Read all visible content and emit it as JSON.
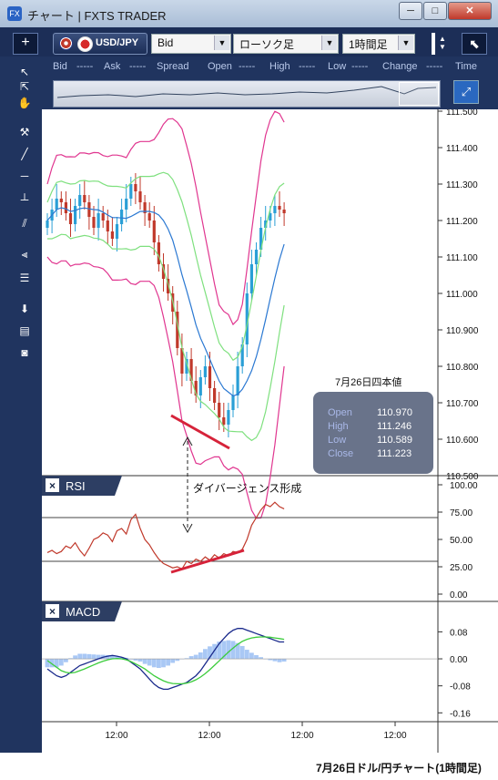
{
  "window": {
    "title": "チャート | FXTS TRADER",
    "app_icon": "FX",
    "controls": {
      "minimize": "minimize-icon",
      "maximize": "maximize-icon",
      "close": "close-icon"
    }
  },
  "toolbar": {
    "plus_label": "+",
    "pair_label": "USD/JPY",
    "price_type": "Bid",
    "chart_type": "ローソク足",
    "timeframe": "1時間足",
    "export_icon": "arrow-up-left-icon"
  },
  "quote_row": {
    "labels": [
      "Bid",
      "-----",
      "Ask",
      "-----",
      "Spread",
      "Open",
      "-----",
      "High",
      "-----",
      "Low",
      "-----",
      "Change",
      "-----",
      "Time"
    ]
  },
  "tools": [
    "pointer-icon",
    "crosshair-pointer-icon",
    "hand-icon",
    "hammer-icon",
    "trendline-icon",
    "horizontal-line-icon",
    "vertical-line-icon",
    "channel-icon",
    "fan-icon",
    "fibonacci-icon",
    "download-icon",
    "list-icon",
    "camera-icon"
  ],
  "ohlc_box": {
    "title": "7月26日四本値",
    "rows": [
      {
        "label": "Open",
        "value": "110.970"
      },
      {
        "label": "High",
        "value": "111.246"
      },
      {
        "label": "Low",
        "value": "110.589"
      },
      {
        "label": "Close",
        "value": "111.223"
      }
    ]
  },
  "annotation": "ダイバージェンス形成",
  "caption": "7月26日ドル/円チャート(1時間足)",
  "panels": {
    "rsi": {
      "title": "RSI",
      "close": "×"
    },
    "macd": {
      "title": "MACD",
      "close": "×"
    }
  },
  "colors": {
    "up": "#2a9fd6",
    "down": "#c0392b",
    "bollinger_outer": "#e0358f",
    "bollinger_inner": "#7ee07e",
    "middle": "#2a78d2",
    "rsi_line": "#c0392b",
    "macd_line": "#1a2a8c",
    "signal_line": "#3ccc3c",
    "histogram": "#a9c8f5",
    "divergence": "#d6233a"
  },
  "chart_data": [
    {
      "type": "candlestick",
      "title": "",
      "x_tick_labels": [
        "12:00",
        "12:00",
        "12:00",
        "12:00"
      ],
      "y_tick_labels": [
        "111.500",
        "111.400",
        "111.300",
        "111.200",
        "111.100",
        "111.000",
        "110.900",
        "110.800",
        "110.700",
        "110.600",
        "110.500"
      ],
      "ylim": [
        110.5,
        111.5
      ],
      "close_path": [
        111.2,
        111.23,
        111.26,
        111.25,
        111.22,
        111.19,
        111.24,
        111.27,
        111.25,
        111.21,
        111.18,
        111.22,
        111.2,
        111.17,
        111.15,
        111.19,
        111.23,
        111.26,
        111.3,
        111.28,
        111.25,
        111.22,
        111.2,
        111.14,
        111.08,
        111.04,
        111.0,
        110.95,
        110.85,
        110.78,
        110.82,
        110.76,
        110.72,
        110.77,
        110.8,
        110.74,
        110.7,
        110.66,
        110.64,
        110.68,
        110.72,
        110.8,
        110.86,
        111.0,
        111.08,
        111.12,
        111.18,
        111.2,
        111.22,
        111.24,
        111.23,
        111.22
      ]
    },
    {
      "type": "line",
      "title": "RSI",
      "y_tick_labels": [
        "100.00",
        "75.00",
        "50.00",
        "25.00",
        "0.00"
      ],
      "ylim": [
        0,
        100
      ],
      "reference_lines": [
        70,
        30
      ],
      "values": [
        38,
        40,
        37,
        39,
        44,
        42,
        47,
        40,
        35,
        42,
        50,
        52,
        56,
        54,
        48,
        58,
        60,
        55,
        68,
        73,
        60,
        50,
        45,
        38,
        32,
        28,
        26,
        24,
        25,
        23,
        30,
        28,
        32,
        30,
        34,
        31,
        36,
        33,
        37,
        35,
        39,
        38,
        41,
        50,
        63,
        70,
        77,
        82,
        80,
        84,
        80,
        78
      ]
    },
    {
      "type": "line",
      "title": "MACD",
      "y_tick_labels": [
        "0.08",
        "0.00",
        "-0.08",
        "-0.16"
      ],
      "ylim": [
        -0.17,
        0.1
      ],
      "series": [
        {
          "values": [
            -0.03,
            -0.04,
            -0.05,
            -0.055,
            -0.05,
            -0.04,
            -0.03,
            -0.02,
            -0.015,
            -0.01,
            -0.005,
            0.0,
            0.005,
            0.008,
            0.01,
            0.008,
            0.005,
            0.0,
            -0.01,
            -0.02,
            -0.03,
            -0.045,
            -0.06,
            -0.075,
            -0.085,
            -0.09,
            -0.09,
            -0.085,
            -0.08,
            -0.075,
            -0.07,
            -0.06,
            -0.05,
            -0.035,
            -0.015,
            0.005,
            0.025,
            0.045,
            0.06,
            0.075,
            0.085,
            0.09,
            0.09,
            0.085,
            0.08,
            0.075,
            0.07,
            0.065,
            0.06,
            0.055,
            0.05,
            0.05
          ]
        },
        {
          "values": [
            -0.005,
            -0.015,
            -0.025,
            -0.035,
            -0.04,
            -0.042,
            -0.04,
            -0.035,
            -0.03,
            -0.024,
            -0.018,
            -0.012,
            -0.007,
            -0.003,
            0.0,
            0.001,
            0.0,
            -0.003,
            -0.008,
            -0.015,
            -0.022,
            -0.03,
            -0.04,
            -0.05,
            -0.058,
            -0.065,
            -0.07,
            -0.073,
            -0.074,
            -0.074,
            -0.072,
            -0.068,
            -0.062,
            -0.054,
            -0.044,
            -0.032,
            -0.019,
            -0.006,
            0.007,
            0.02,
            0.032,
            0.043,
            0.052,
            0.058,
            0.062,
            0.064,
            0.065,
            0.065,
            0.064,
            0.062,
            0.06,
            0.058
          ]
        }
      ]
    }
  ]
}
